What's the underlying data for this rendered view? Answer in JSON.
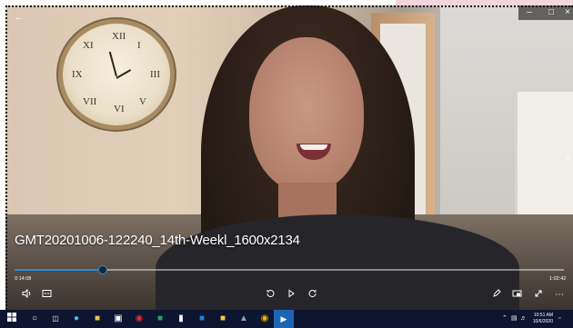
{
  "player": {
    "title": "GMT20201006-122240_14th-Weekl_1600x2134",
    "current_time": "0:14:08",
    "total_time": "1:02:42",
    "progress_fraction": 0.16,
    "accent_color": "#2a8fd8"
  },
  "icons": {
    "back": "back-arrow-icon",
    "volume": "volume-icon",
    "captions": "captions-icon",
    "skip_back": "skip-back-10-icon",
    "play": "play-icon",
    "skip_forward": "skip-forward-30-icon",
    "edit": "pen-icon",
    "miniview": "mini-view-icon",
    "fullscreen": "fullscreen-icon",
    "more": "more-icon"
  },
  "taskbar": {
    "clock_time": "10:51 AM",
    "clock_date": "10/6/2020",
    "background": "#0d1530"
  }
}
